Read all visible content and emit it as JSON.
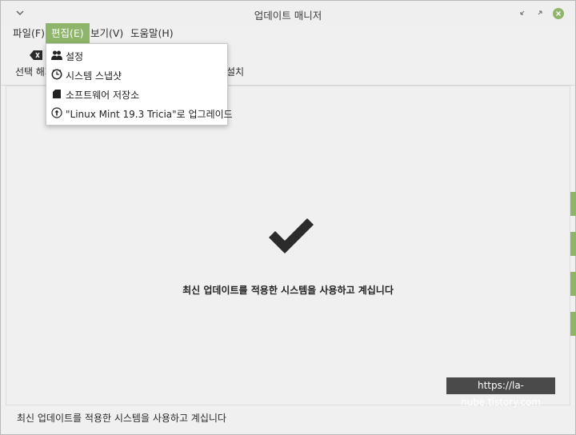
{
  "window": {
    "title": "업데이트 매니저"
  },
  "menubar": {
    "items": [
      {
        "label": "파일(F)"
      },
      {
        "label": "편집(E)"
      },
      {
        "label": "보기(V)"
      },
      {
        "label": "도움말(H)"
      }
    ]
  },
  "toolbar": {
    "clear_label": "선택 해제",
    "install_label": "설치"
  },
  "edit_menu": {
    "items": [
      {
        "label": "설정",
        "icon": "users-settings-icon"
      },
      {
        "label": "시스템 스냅샷",
        "icon": "clock-icon"
      },
      {
        "label": "소프트웨어 저장소",
        "icon": "package-icon"
      },
      {
        "label": "\"Linux Mint 19.3 Tricia\"로 업그레이드",
        "icon": "upgrade-arrow-icon"
      }
    ]
  },
  "main": {
    "message": "최신 업데이트를 적용한 시스템을 사용하고 계십니다"
  },
  "watermark": {
    "text": "https://la-nube.tistory.com"
  },
  "statusbar": {
    "text": "최신 업데이트를 적용한 시스템을 사용하고 계십니다"
  },
  "colors": {
    "accent": "#8fb56a",
    "background": "#f0f0f0",
    "watermark_bg": "#4a4a4a"
  }
}
